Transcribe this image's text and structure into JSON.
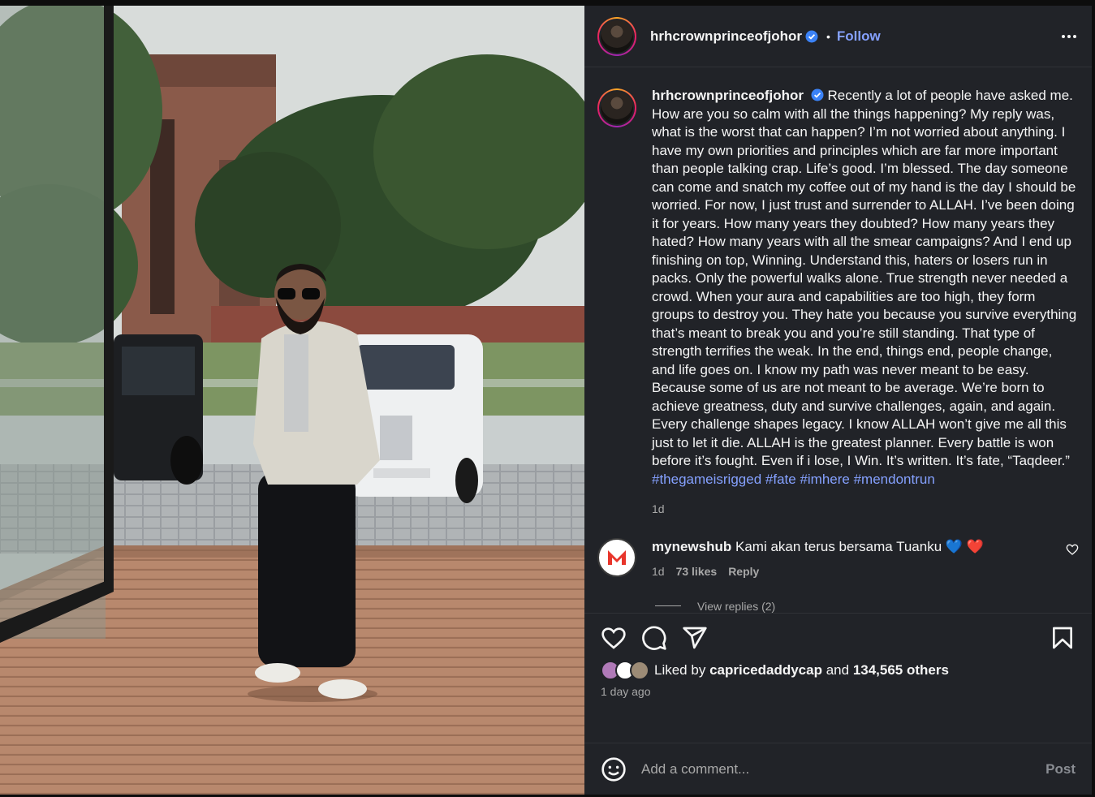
{
  "post": {
    "username": "hrhcrownprinceofjohor",
    "follow_label": "Follow",
    "dot": "•"
  },
  "caption": {
    "username": "hrhcrownprinceofjohor",
    "text": "Recently a lot of people have asked me. How are you so calm with all the things happening? My reply was, what is the worst that can happen? I’m not worried about anything. I have my own priorities and principles which are far more important than people talking crap. Life’s good. I’m blessed. The day someone can come and snatch my coffee out of my hand is the day I should be worried. For now, I just trust and surrender to ALLAH. I’ve been doing it for years. How many years they doubted? How many years they hated? How many years with all the smear campaigns? And I end up finishing on top, Winning. Understand this, haters or losers run in packs. Only the powerful walks alone. True strength never needed a crowd. When your aura and capabilities are too high, they form groups to destroy you. They hate you because you survive everything that’s meant to break you and you’re still standing. That type of strength terrifies the weak. In the end, things end, people change, and life goes on. I know my path was never meant to be easy. Because some of us are not meant to be average. We’re born to achieve greatness, duty and survive challenges, again, and again. Every challenge shapes legacy. I know ALLAH won’t give me all this just to let it die. ALLAH is the greatest planner. Every battle is won before it’s fought. Even if i lose, I Win. It’s written. It’s fate, “Taqdeer.”",
    "hashtags": [
      "#thegameisrigged",
      "#fate",
      "#imhere",
      "#mendontrun"
    ],
    "time": "1d"
  },
  "comment": {
    "username": "mynewshub",
    "text": "Kami akan terus bersama Tuanku",
    "emojis": "💙 ❤️",
    "time": "1d",
    "likes": "73 likes",
    "reply_label": "Reply",
    "view_replies": "View replies (2)"
  },
  "likes": {
    "prefix": "Liked by",
    "user": "capricedaddycap",
    "middle": "and",
    "count": "134,565 others",
    "ago": "1 day ago"
  },
  "composer": {
    "placeholder": "Add a comment...",
    "post_label": "Post"
  },
  "icons": {
    "like": "heart-icon",
    "comment": "comment-icon",
    "share": "share-icon",
    "save": "bookmark-icon",
    "emoji": "emoji-icon",
    "verified": "verified-badge-icon"
  },
  "colors": {
    "panel_bg": "#212328",
    "link": "#85a1ff",
    "muted": "#a8a8a8",
    "text": "#f5f5f5"
  }
}
